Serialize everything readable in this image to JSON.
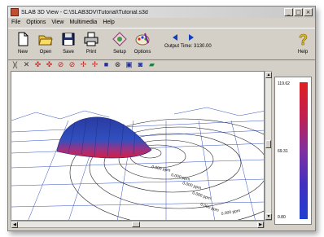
{
  "window": {
    "title": "SLAB 3D View - C:\\SLAB3DV\\Tutorial\\Tutorial.s3d"
  },
  "window_buttons": {
    "minimize": "_",
    "maximize": "□",
    "close": "×"
  },
  "menu": [
    "File",
    "Options",
    "View",
    "Multimedia",
    "Help"
  ],
  "toolbar": {
    "new": "New",
    "open": "Open",
    "save": "Save",
    "print": "Print",
    "setup": "Setup",
    "options": "Options",
    "help": "Help",
    "output_time_label": "Output Time:",
    "output_time_value": "3130.00"
  },
  "legend": {
    "max": "119.62",
    "mid": "69.31",
    "min": "0.80"
  },
  "contours": [
    "0.000 ppm",
    "0.000 ppm",
    "0.000 ppm",
    "0.000 ppm",
    "0.000 ppm",
    "0.000 ppm"
  ],
  "colors": {
    "accent": "#e02020",
    "plume_top": "#2a3aa0",
    "plume_core": "#d02040"
  }
}
